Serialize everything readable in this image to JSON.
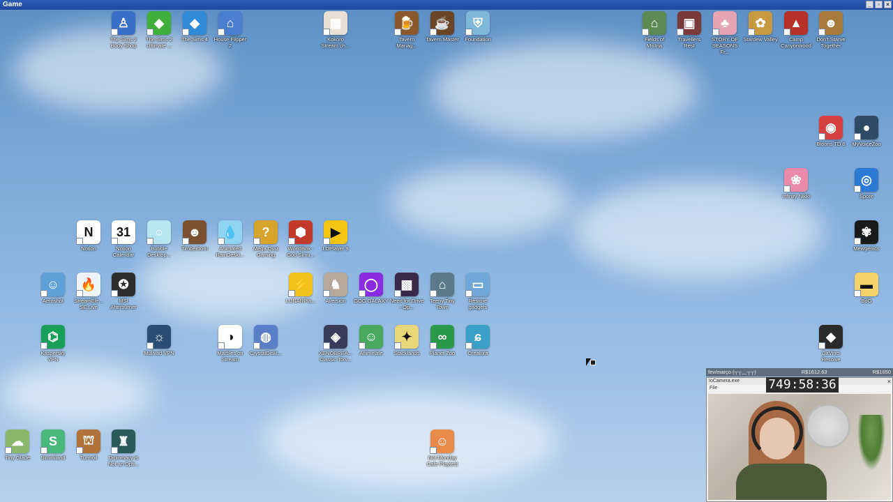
{
  "window": {
    "title": "Game",
    "buttons": [
      "_",
      "▫",
      "×"
    ]
  },
  "desktop_icons": [
    {
      "label": "The Sims 2 Body Shop",
      "icon": "sims-body-shop-icon",
      "color": "#3a6fc9",
      "glyph": "♙"
    },
    {
      "label": "The Sims 2 Ultimate ...",
      "icon": "sims2-icon",
      "color": "#3fae3a",
      "glyph": "◆"
    },
    {
      "label": "The Sims 4",
      "icon": "sims4-icon",
      "color": "#2f8ad8",
      "glyph": "◆"
    },
    {
      "label": "House Flipper 2",
      "icon": "house-flipper-icon",
      "color": "#4a7fd0",
      "glyph": "⌂"
    },
    {
      "label": "Kokoro Stream ch...",
      "icon": "kokoro-icon",
      "color": "#e8e0d4",
      "glyph": "▦"
    },
    {
      "label": "Tavern Manag...",
      "icon": "tavern-manager-icon",
      "color": "#8a5a2e",
      "glyph": "🍺"
    },
    {
      "label": "Tavern Master",
      "icon": "tavern-master-icon",
      "color": "#6b4526",
      "glyph": "☕"
    },
    {
      "label": "Foundation",
      "icon": "foundation-icon",
      "color": "#7fb7d8",
      "glyph": "⛨"
    },
    {
      "label": "Fields of Mistria",
      "icon": "fields-of-mistria-icon",
      "color": "#5b8a52",
      "glyph": "⌂"
    },
    {
      "label": "Travellers Rest",
      "icon": "travellers-rest-icon",
      "color": "#7a3a3a",
      "glyph": "▣"
    },
    {
      "label": "STORY OF SEASONS Fr...",
      "icon": "story-of-seasons-icon",
      "color": "#e6a3b3",
      "glyph": "♣"
    },
    {
      "label": "Stardew Valley",
      "icon": "stardew-valley-icon",
      "color": "#c79a3f",
      "glyph": "✿"
    },
    {
      "label": "Camp Canyonwood",
      "icon": "camp-canyonwood-icon",
      "color": "#b8302a",
      "glyph": "▲"
    },
    {
      "label": "Don't Starve Together",
      "icon": "dont-starve-icon",
      "color": "#a67b3c",
      "glyph": "☻"
    },
    {
      "label": "Bloons TD 6",
      "icon": "bloons-td6-icon",
      "color": "#d64040",
      "glyph": "◉"
    },
    {
      "label": "MyVoiceZoo",
      "icon": "myvoicezoo-icon",
      "color": "#2e4a66",
      "glyph": "●"
    },
    {
      "label": "Infinity Nikki",
      "icon": "infinity-nikki-icon",
      "color": "#e88aa8",
      "glyph": "❀"
    },
    {
      "label": "Spore",
      "icon": "spore-icon",
      "color": "#2b7ad3",
      "glyph": "◎"
    },
    {
      "label": "Mewgenics",
      "icon": "mewgenics-icon",
      "color": "#1a1a1a",
      "glyph": "✾"
    },
    {
      "label": "Notion",
      "icon": "notion-icon",
      "color": "#ffffff",
      "glyph": "N",
      "dark": true
    },
    {
      "label": "Notion Calendar",
      "icon": "notion-calendar-icon",
      "color": "#ffffff",
      "glyph": "31",
      "dark": true
    },
    {
      "label": "Bubble Desktop...",
      "icon": "bubble-icon",
      "color": "#b8e6f0",
      "glyph": "○"
    },
    {
      "label": "Timberborn",
      "icon": "timberborn-icon",
      "color": "#7a5231",
      "glyph": "☻"
    },
    {
      "label": "Animated RainDeskt...",
      "icon": "rain-desktop-icon",
      "color": "#8fd4f0",
      "glyph": "💧"
    },
    {
      "label": "Mega Quiz Gaming",
      "icon": "mega-quiz-icon",
      "color": "#d6a42a",
      "glyph": "?"
    },
    {
      "label": "WorldBox - God Simu...",
      "icon": "worldbox-icon",
      "color": "#c23a2a",
      "glyph": "⬢"
    },
    {
      "label": "LDPlayer 9",
      "icon": "ldplayer-icon",
      "color": "#f4c613",
      "glyph": "▶",
      "dark": true
    },
    {
      "label": "Aeroshot",
      "icon": "aeroshot-icon",
      "color": "#5ea0d8",
      "glyph": "☺"
    },
    {
      "label": "StreamEle... SE.Live",
      "icon": "streamelements-icon",
      "color": "#eef3f8",
      "glyph": "🔥",
      "dark": true
    },
    {
      "label": "MSI Afterburner",
      "icon": "msi-afterburner-icon",
      "color": "#2c2c2c",
      "glyph": "✪"
    },
    {
      "label": "LUNARPla...",
      "icon": "lunar-icon",
      "color": "#f2c21c",
      "glyph": "⚡",
      "dark": true
    },
    {
      "label": "Aversion",
      "icon": "aversion-icon",
      "color": "#b8a89a",
      "glyph": "♞"
    },
    {
      "label": "GOG GALAXY",
      "icon": "gog-galaxy-icon",
      "color": "#8a2be2",
      "glyph": "◯"
    },
    {
      "label": "Need for Drive - Op...",
      "icon": "need-for-drive-icon",
      "color": "#3a2a4a",
      "glyph": "▩"
    },
    {
      "label": "Teeny Tiny Town",
      "icon": "teeny-tiny-town-icon",
      "color": "#5a7a8a",
      "glyph": "⌂"
    },
    {
      "label": "Restore gadgets",
      "icon": "restore-gadgets-icon",
      "color": "#6fa8d8",
      "glyph": "▭"
    },
    {
      "label": "BdG",
      "icon": "folder-icon",
      "color": "#f3d26a",
      "glyph": "▬",
      "dark": true
    },
    {
      "label": "Kaspersky VPN",
      "icon": "kaspersky-vpn-icon",
      "color": "#18a058",
      "glyph": "⌬"
    },
    {
      "label": "Mullvad VPN",
      "icon": "mullvad-vpn-icon",
      "color": "#294d73",
      "glyph": "☼"
    },
    {
      "label": "Marbles on Stream",
      "icon": "marbles-icon",
      "color": "#ffffff",
      "glyph": "◑",
      "dark": true
    },
    {
      "label": "CrystalDiskI...",
      "icon": "crystaldisk-icon",
      "color": "#5a7fc8",
      "glyph": "◍"
    },
    {
      "label": "XENOBREA... Classic Torv...",
      "icon": "xenobrea-icon",
      "color": "#3a3a5a",
      "glyph": "◈"
    },
    {
      "label": "Animelate",
      "icon": "animelate-icon",
      "color": "#48a85e",
      "glyph": "☺"
    },
    {
      "label": "Stacklands",
      "icon": "stacklands-icon",
      "color": "#e8d67a",
      "glyph": "✦",
      "dark": true
    },
    {
      "label": "Planet Zoo",
      "icon": "planet-zoo-icon",
      "color": "#2a9a4a",
      "glyph": "∞"
    },
    {
      "label": "Creatura",
      "icon": "creatura-icon",
      "color": "#3aa0c8",
      "glyph": "ɕ"
    },
    {
      "label": "DaVinci Resolve",
      "icon": "davinci-resolve-icon",
      "color": "#2a2a2a",
      "glyph": "◆"
    },
    {
      "label": "Tiny Glade",
      "icon": "tiny-glade-icon",
      "color": "#8ab86a",
      "glyph": "☁"
    },
    {
      "label": "Simmiland",
      "icon": "simmiland-icon",
      "color": "#4ab87a",
      "glyph": "S"
    },
    {
      "label": "Turmoil",
      "icon": "turmoil-icon",
      "color": "#b0733a",
      "glyph": "⛫"
    },
    {
      "label": "Diplomacy is Not an Opti...",
      "icon": "diplomacy-icon",
      "color": "#2a5a5a",
      "glyph": "♜"
    },
    {
      "label": "Not Monday Cafe Playtest",
      "icon": "not-monday-cafe-icon",
      "color": "#e88a4a",
      "glyph": "☺"
    }
  ],
  "overlay": {
    "left_text": "fev/março (┬┬﹏┬┬)",
    "mid_text": "R$1612.63",
    "right_text": "R$1650",
    "camera_title": "IoCamera.exe",
    "camera_menu": "File",
    "close": "×",
    "timer": "749:58:36"
  }
}
